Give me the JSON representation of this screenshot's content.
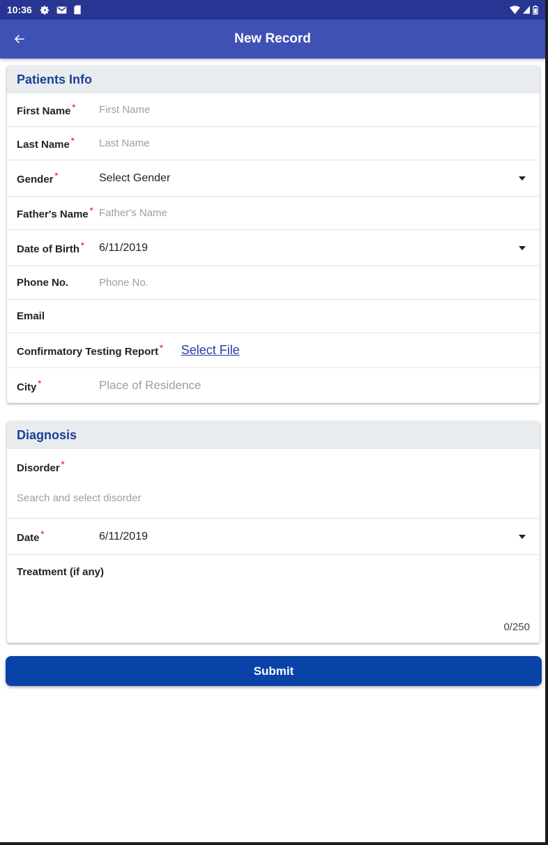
{
  "status_bar": {
    "time": "10:36",
    "icons_left": [
      "settings-icon",
      "gmail-icon",
      "sd-card-icon"
    ],
    "icons_right": [
      "wifi-icon",
      "cell-signal-icon",
      "battery-icon"
    ]
  },
  "app_bar": {
    "title": "New Record",
    "back_icon": "arrow-back-icon",
    "color": "#3f51b5"
  },
  "patients_info": {
    "header": "Patients Info",
    "required_mark": "*",
    "first_name": {
      "label": "First Name",
      "placeholder": "First Name",
      "required": true
    },
    "last_name": {
      "label": "Last Name",
      "placeholder": "Last Name",
      "required": true
    },
    "gender": {
      "label": "Gender",
      "value": "Select Gender",
      "required": true
    },
    "fathers_name": {
      "label": "Father's Name",
      "placeholder": "Father's Name",
      "required": true
    },
    "dob": {
      "label": "Date of Birth",
      "value": "6/11/2019",
      "required": true
    },
    "phone": {
      "label": "Phone No.",
      "placeholder": "Phone No.",
      "required": false
    },
    "email": {
      "label": "Email",
      "required": false
    },
    "report": {
      "label": "Confirmatory Testing Report",
      "link": "Select File",
      "required": true
    },
    "city": {
      "label": "City",
      "placeholder": "Place of Residence",
      "required": true
    }
  },
  "diagnosis": {
    "header": "Diagnosis",
    "required_mark": "*",
    "disorder": {
      "label": "Disorder",
      "placeholder": "Search and select disorder",
      "required": true
    },
    "date": {
      "label": "Date",
      "value": "6/11/2019",
      "required": true
    },
    "treatment": {
      "label": "Treatment (if any)",
      "counter": "0/250"
    }
  },
  "submit": {
    "label": "Submit",
    "color": "#0a43a8"
  }
}
